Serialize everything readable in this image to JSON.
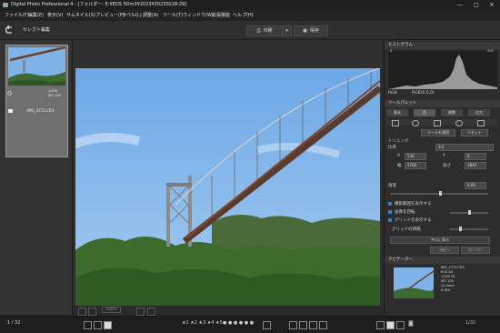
{
  "window": {
    "title": "Digital Photo Professional 4 - [フォルダー: E:¥EOS 5Dm3¥2023¥20230228-29]",
    "minimize": "—",
    "maximize": "□",
    "close": "✕"
  },
  "menubar": {
    "items": [
      "ファイル(F)",
      "編集(E)",
      "表示(V)",
      "サムネイル(S)",
      "プレビュー(P)",
      "ラベル(L)",
      "調整(A)",
      "ツール(T)",
      "ウィンドウ(W)",
      "拡張機能",
      "ヘルプ(H)"
    ]
  },
  "toolbar": {
    "back_icon": "back-arrow-icon",
    "mode_label": "セレクト編集",
    "print_label": "印刷",
    "save_label": "保存"
  },
  "filmstrip": {
    "thumb_name": "IMG_4715.CR3",
    "thumb_info1": "1/200",
    "thumb_info2": "ISO 100",
    "page": "1 / 32"
  },
  "histogram": {
    "title": "ヒストグラム",
    "label_left": "0",
    "label_right": "255",
    "rgb_label": "RGB",
    "readout": "RGB(0,0,0)"
  },
  "toolpalette": {
    "title": "ツールパレット",
    "tab1": "基本",
    "tab2": "色",
    "tab3": "調整",
    "tab4": "出力",
    "apply_btn": "ツールを適用",
    "reset_btn": "リセット",
    "trim_heading": "トリミング",
    "ratio_label": "比率",
    "ratio_value": "3:2",
    "x_label": "X",
    "y_label": "Y",
    "x_value": "536",
    "y_value": "0",
    "w_label": "幅",
    "h_label": "高さ",
    "w_value": "5760",
    "h_value": "3840",
    "angle_label": "角度",
    "angle_value": "0.00",
    "cb1_label": "撮影範囲を表示する",
    "cb2_label": "画像を回転",
    "cb3_label": "グリッドを表示する",
    "grid_label": "グリッドの間隔",
    "center_btn": "中心に表示",
    "copy_btn": "コピー",
    "paste_btn": "貼り付け"
  },
  "navigator": {
    "title": "ナビゲーター",
    "info1": "IMG_4715.CR3",
    "info2": "EOS 5D",
    "info3": "1/200 F8",
    "info4": "ISO 100",
    "info5": "24.0mm",
    "info6": "0.0EV"
  },
  "viewer": {
    "zoom": "100%"
  },
  "statusbar": {
    "page": "1 / 32",
    "right_count": "1/32"
  }
}
